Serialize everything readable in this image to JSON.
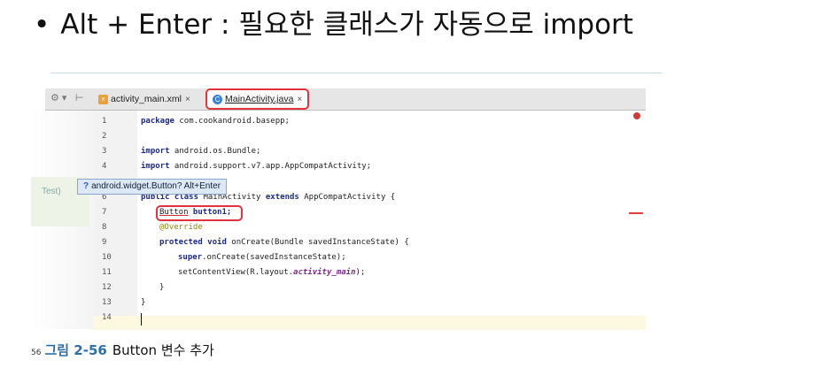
{
  "slide": {
    "bullet": "•",
    "heading": "Alt + Enter : 필요한 클래스가 자동으로 import"
  },
  "editor": {
    "toolbar_icons": "⚙▾ ⊢",
    "tabs": [
      {
        "label": "activity_main.xml",
        "close": "×",
        "active": false
      },
      {
        "label": "MainActivity.java",
        "close": "×",
        "active": true
      }
    ],
    "side_label": "Test)",
    "popup_prefix": "?",
    "popup_text": "android.widget.Button? Alt+Enter",
    "line_numbers": [
      "1",
      "2",
      "3",
      "4",
      "5",
      "6",
      "7",
      "8",
      "9",
      "10",
      "11",
      "12",
      "13",
      "14"
    ],
    "code": {
      "l1_kw": "package",
      "l1_rest": " com.cookandroid.basepp;",
      "l3_kw": "import",
      "l3_rest": " android.os.Bundle;",
      "l4_kw": "import",
      "l4_rest": " android.support.v7.app.AppCompatActivity;",
      "l6_kw": "public class",
      "l6_rest": " MainActivity ",
      "l6_kw2": "extends",
      "l6_rest2": " AppCompatActivity {",
      "l7_type": "Button",
      "l7_rest": " button1;",
      "l8": "@Override",
      "l9_kw": "protected void",
      "l9_rest": " onCreate(Bundle savedInstanceState) {",
      "l10_kw": "super",
      "l10_rest": ".onCreate(savedInstanceState);",
      "l11_pre": "setContentView(R.layout.",
      "l11_ital": "activity_main",
      "l11_post": ");",
      "l12": "}",
      "l13": "}"
    }
  },
  "caption": {
    "page": "56",
    "figure_label": "그림 2-56",
    "text": "Button 변수 추가"
  },
  "colors": {
    "highlight_red": "#e0323f",
    "figure_label_blue": "#2f6fa8",
    "keyword_navy": "#1b2a8a"
  }
}
